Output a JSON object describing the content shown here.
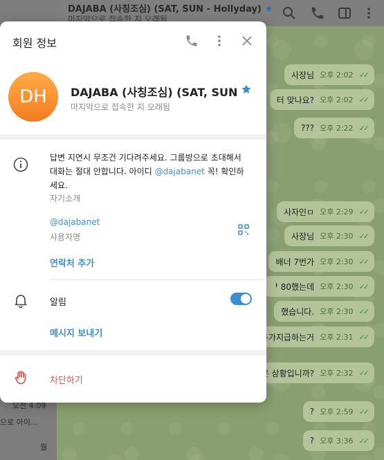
{
  "background": {
    "chat_title": "DAJABA (사칭조심) (SAT, SUN - Hollyday)",
    "chat_status": "마지막으로 접속한 지 오래됨",
    "sidebar_items": [
      {
        "text": "오전 4:09"
      },
      {
        "text": "으로 아이..."
      },
      {
        "text": "월"
      }
    ],
    "messages": [
      {
        "text": "사장님",
        "time": "오후 2:02"
      },
      {
        "text": "터 맞나요?",
        "time": "오후 2:02"
      },
      {
        "text": "???",
        "time": "오후 2:22"
      },
      {
        "text": "사자인ㅁ",
        "time": "오후 2:29"
      },
      {
        "text": "사장님",
        "time": "오후 2:30"
      },
      {
        "text": "배너 7번가",
        "time": "오후 2:30"
      },
      {
        "text": "ᅡ 80했는데",
        "time": "오후 2:30"
      },
      {
        "text": "했습니다.",
        "time": "오후 2:30"
      },
      {
        "text": "인트 추가지급하는거",
        "time": "오후 2:31"
      },
      {
        "text": "뚱맞은 상황입니까?",
        "time": "오후 2:32"
      },
      {
        "text": "?",
        "time": "오후 2:59"
      },
      {
        "text": "?",
        "time": "오후 3:36"
      }
    ]
  },
  "modal": {
    "title": "회원 정보",
    "avatar_initials": "DH",
    "avatar_colors": {
      "top": "#ffab4a",
      "bottom": "#f27d1f"
    },
    "user_name": "DAJABA (사칭조심) (SAT, SUN ...",
    "user_status": "마지막으로 접속한 지 오래됨",
    "bio": {
      "text_before_link": "답변 지연시 무조건 기다려주세요. 그룹방으로 초대해서 대화는 절대 안합니다. 아이디 ",
      "link": "@dajabanet",
      "text_after_link": " 꼭! 확인하세요.",
      "label": "자기소개"
    },
    "username": {
      "value": "@dajabanet",
      "label": "사용자명"
    },
    "add_contact_label": "연락처 추가",
    "notifications": {
      "label": "알림",
      "enabled": true
    },
    "send_message_label": "메시지 보내기",
    "block_label": "차단하기"
  },
  "colors": {
    "accent": "#3a8fd1",
    "danger": "#d9534f"
  }
}
